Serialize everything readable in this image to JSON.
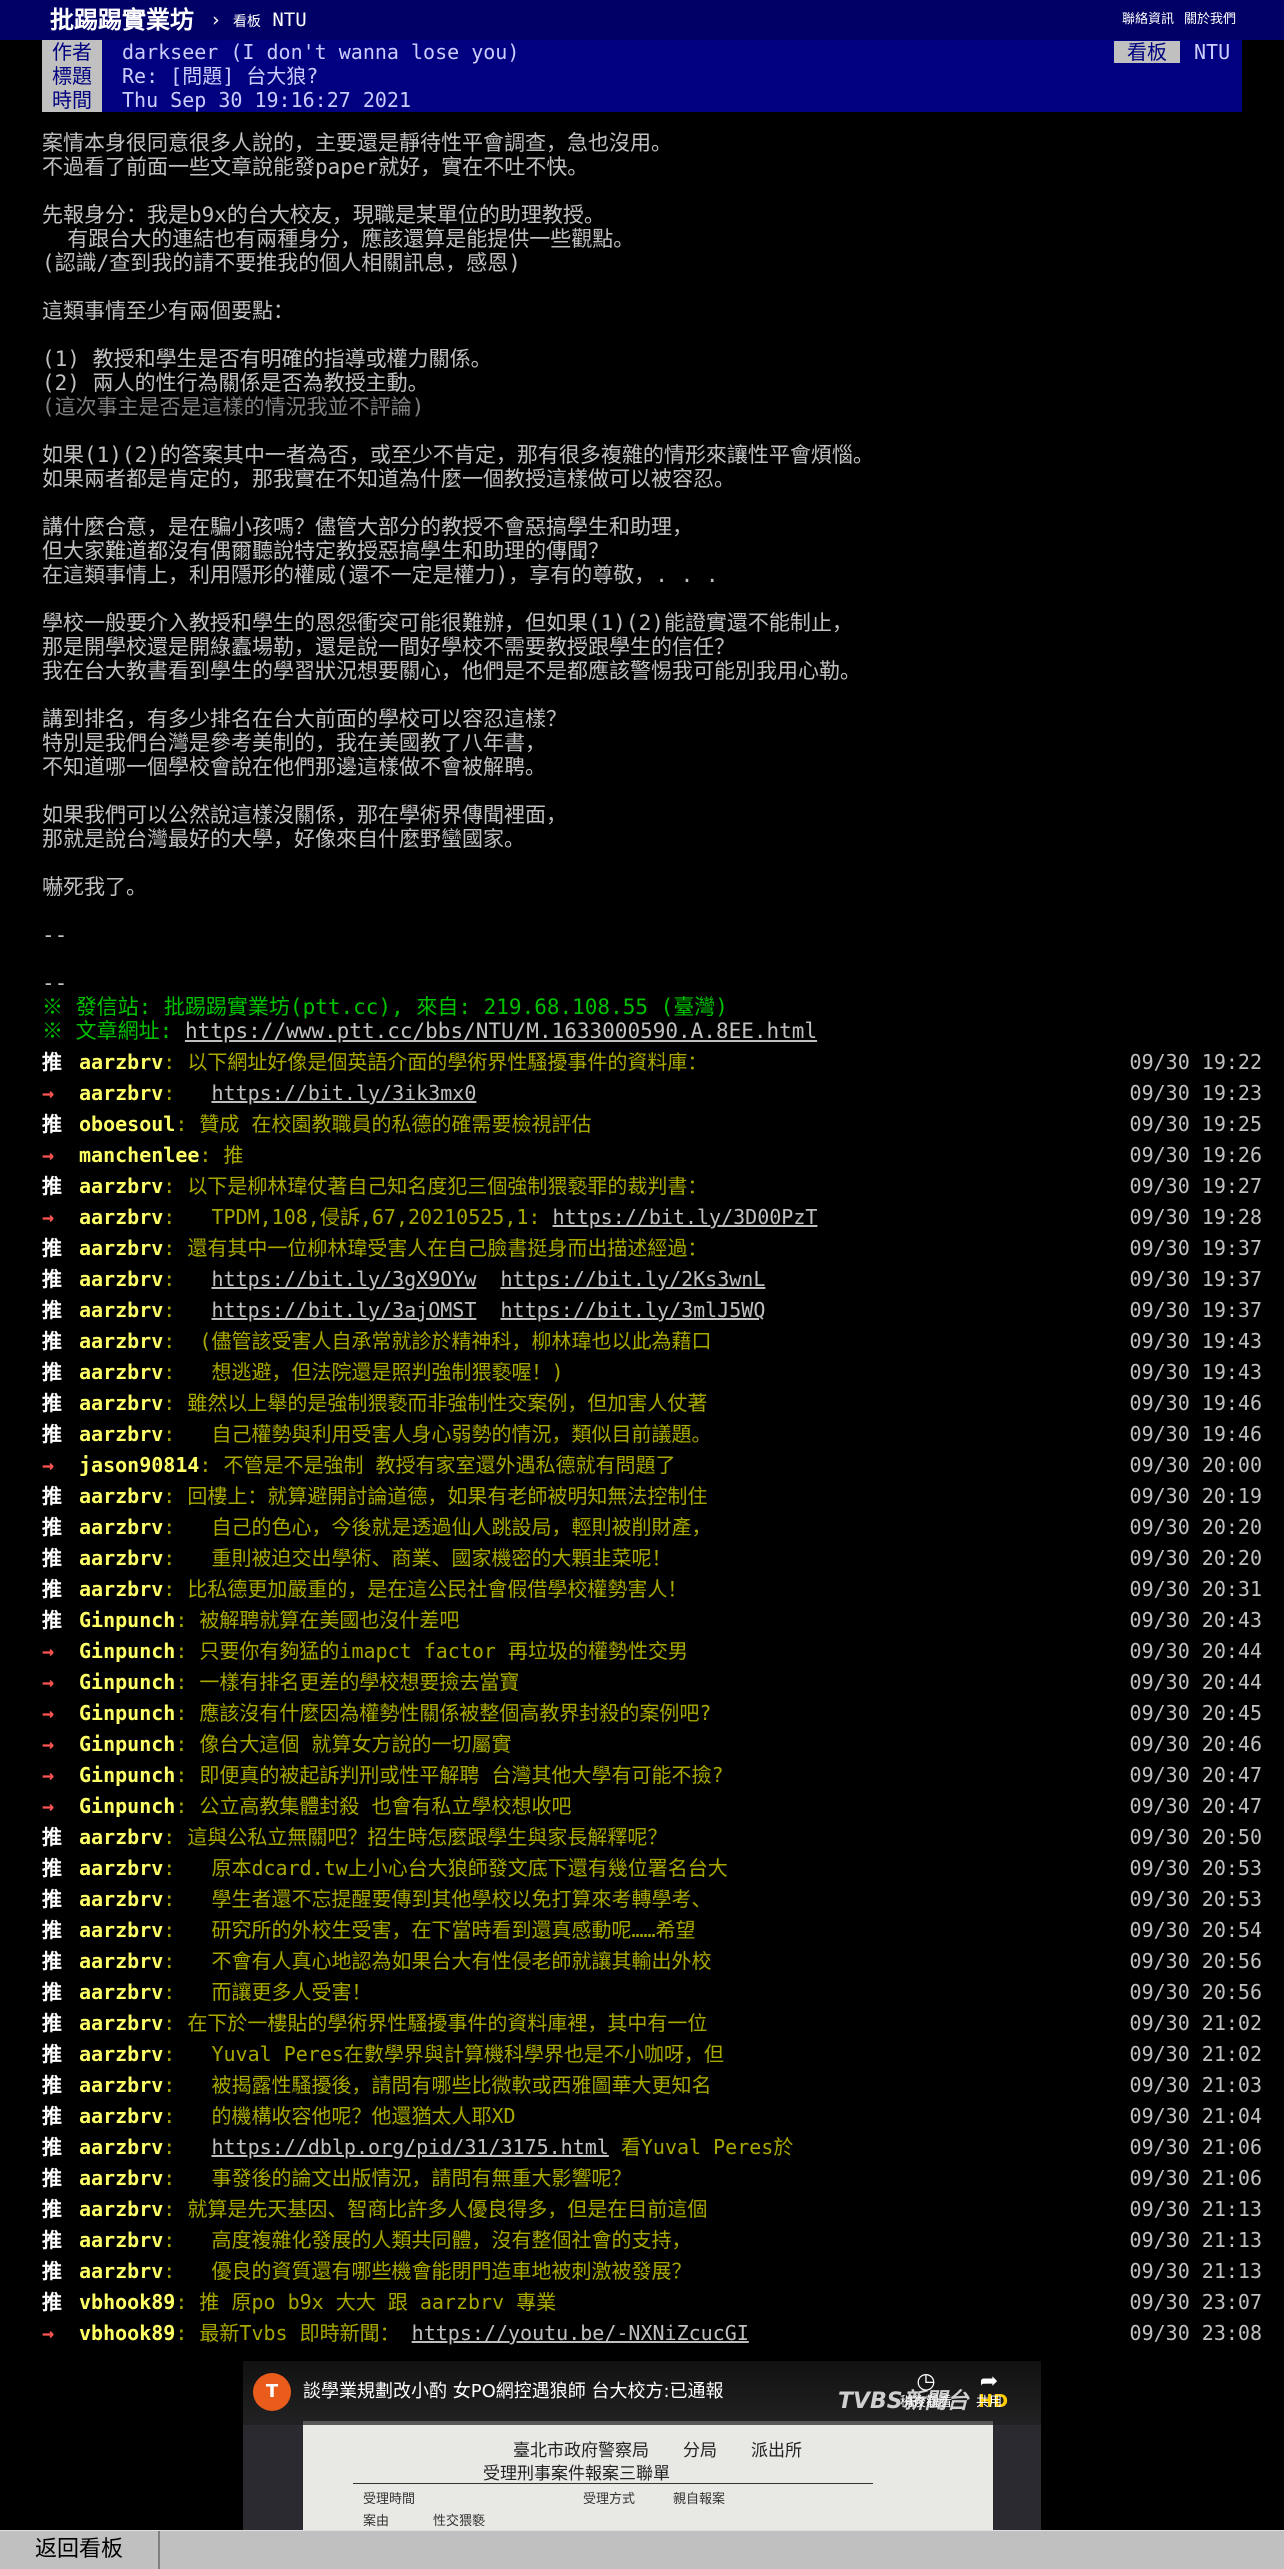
{
  "topbar": {
    "brand": "批踢踢實業坊",
    "separator": "›",
    "board_prefix": "看板",
    "board": "NTU",
    "links": [
      "聯絡資訊",
      "關於我們"
    ]
  },
  "meta": {
    "author_label": "作者",
    "author": "darkseer (I don't wanna lose you)",
    "board_label": "看板",
    "board": "NTU",
    "title_label": "標題",
    "title": "Re: [問題] 台大狼?",
    "time_label": "時間",
    "time": "Thu Sep 30 19:16:27 2021"
  },
  "body": [
    {
      "text": "案情本身很同意很多人說的，主要還是靜待性平會調查，急也沒用。"
    },
    {
      "text": "不過看了前面一些文章說能發paper就好，實在不吐不快。"
    },
    {
      "text": ""
    },
    {
      "text": "先報身分：我是b9x的台大校友，現職是某單位的助理教授。"
    },
    {
      "text": "  有跟台大的連結也有兩種身分，應該還算是能提供一些觀點。"
    },
    {
      "text": "(認識/查到我的請不要推我的個人相關訊息，感恩)"
    },
    {
      "text": ""
    },
    {
      "text": "這類事情至少有兩個要點："
    },
    {
      "text": ""
    },
    {
      "text": "(1) 教授和學生是否有明確的指導或權力關係。"
    },
    {
      "text": "(2) 兩人的性行為關係是否為教授主動。"
    },
    {
      "text": "(這次事主是否是這樣的情況我並不評論)",
      "dim": true
    },
    {
      "text": ""
    },
    {
      "text": "如果(1)(2)的答案其中一者為否，或至少不肯定，那有很多複雜的情形來讓性平會煩惱。"
    },
    {
      "text": "如果兩者都是肯定的，那我實在不知道為什麼一個教授這樣做可以被容忍。"
    },
    {
      "text": ""
    },
    {
      "text": "講什麼合意，是在騙小孩嗎？儘管大部分的教授不會惡搞學生和助理，"
    },
    {
      "text": "但大家難道都沒有偶爾聽說特定教授惡搞學生和助理的傳聞？"
    },
    {
      "text": "在這類事情上，利用隱形的權威(還不一定是權力)，享有的尊敬，. . ."
    },
    {
      "text": ""
    },
    {
      "text": "學校一般要介入教授和學生的恩怨衝突可能很難辦，但如果(1)(2)能證實還不能制止，"
    },
    {
      "text": "那是開學校還是開綠蠹場勒，還是說一間好學校不需要教授跟學生的信任？"
    },
    {
      "text": "我在台大教書看到學生的學習狀況想要關心，他們是不是都應該警惕我可能別我用心勒。"
    },
    {
      "text": ""
    },
    {
      "text": "講到排名，有多少排名在台大前面的學校可以容忍這樣？"
    },
    {
      "text": "特別是我們台灣是參考美制的，我在美國教了八年書，"
    },
    {
      "text": "不知道哪一個學校會說在他們那邊這樣做不會被解聘。"
    },
    {
      "text": ""
    },
    {
      "text": "如果我們可以公然說這樣沒關係，那在學術界傳聞裡面，"
    },
    {
      "text": "那就是說台灣最好的大學，好像來自什麼野蠻國家。"
    },
    {
      "text": ""
    },
    {
      "text": "嚇死我了。"
    },
    {
      "text": ""
    },
    {
      "text": "--"
    },
    {
      "text": ""
    },
    {
      "text": "--"
    }
  ],
  "footer": {
    "sent_from": "※ 發信站: 批踢踢實業坊(ptt.cc), 來自: 219.68.108.55 (臺灣)",
    "url_label": "※ 文章網址: ",
    "url": "https://www.ptt.cc/bbs/NTU/M.1633000590.A.8EE.html"
  },
  "pushes": [
    {
      "tag": "推",
      "user": "aarzbrv",
      "content": "以下網址好像是個英語介面的學術界性騷擾事件的資料庫：",
      "time": "09/30 19:22"
    },
    {
      "tag": "→",
      "user": "aarzbrv",
      "content": "  https://bit.ly/3ik3mx0",
      "time": "09/30 19:23"
    },
    {
      "tag": "推",
      "user": "oboesoul",
      "content": "贊成 在校園教職員的私德的確需要檢視評估",
      "time": "09/30 19:25"
    },
    {
      "tag": "→",
      "user": "manchenlee",
      "content": "推",
      "time": "09/30 19:26"
    },
    {
      "tag": "推",
      "user": "aarzbrv",
      "content": "以下是柳林瑋仗著自己知名度犯三個強制猥褻罪的裁判書：",
      "time": "09/30 19:27"
    },
    {
      "tag": "→",
      "user": "aarzbrv",
      "content": "  TPDM,108,侵訴,67,20210525,1: https://bit.ly/3D00PzT",
      "time": "09/30 19:28"
    },
    {
      "tag": "推",
      "user": "aarzbrv",
      "content": "還有其中一位柳林瑋受害人在自己臉書挺身而出描述經過：",
      "time": "09/30 19:37"
    },
    {
      "tag": "推",
      "user": "aarzbrv",
      "content": "  https://bit.ly/3gX9OYw  https://bit.ly/2Ks3wnL",
      "time": "09/30 19:37"
    },
    {
      "tag": "推",
      "user": "aarzbrv",
      "content": "  https://bit.ly/3ajOMST  https://bit.ly/3mlJ5WQ",
      "time": "09/30 19:37"
    },
    {
      "tag": "推",
      "user": "aarzbrv",
      "content": " (儘管該受害人自承常就診於精神科，柳林瑋也以此為藉口",
      "time": "09/30 19:43"
    },
    {
      "tag": "推",
      "user": "aarzbrv",
      "content": "  想逃避，但法院還是照判強制猥褻喔！)",
      "time": "09/30 19:43"
    },
    {
      "tag": "推",
      "user": "aarzbrv",
      "content": "雖然以上舉的是強制猥褻而非強制性交案例，但加害人仗著",
      "time": "09/30 19:46"
    },
    {
      "tag": "推",
      "user": "aarzbrv",
      "content": "  自己權勢與利用受害人身心弱勢的情況，類似目前議題。",
      "time": "09/30 19:46"
    },
    {
      "tag": "→",
      "user": "jason90814",
      "content": "不管是不是強制 教授有家室還外遇私德就有問題了",
      "time": "09/30 20:00"
    },
    {
      "tag": "推",
      "user": "aarzbrv",
      "content": "回樓上：就算避開討論道德，如果有老師被明知無法控制住",
      "time": "09/30 20:19"
    },
    {
      "tag": "推",
      "user": "aarzbrv",
      "content": "  自己的色心，今後就是透過仙人跳設局，輕則被削財產，",
      "time": "09/30 20:20"
    },
    {
      "tag": "推",
      "user": "aarzbrv",
      "content": "  重則被迫交出學術、商業、國家機密的大顆韭菜呢！",
      "time": "09/30 20:20"
    },
    {
      "tag": "推",
      "user": "aarzbrv",
      "content": "比私德更加嚴重的，是在這公民社會假借學校權勢害人！",
      "time": "09/30 20:31"
    },
    {
      "tag": "推",
      "user": "Ginpunch",
      "content": "被解聘就算在美國也沒什差吧",
      "time": "09/30 20:43"
    },
    {
      "tag": "→",
      "user": "Ginpunch",
      "content": "只要你有夠猛的imapct factor 再垃圾的權勢性交男",
      "time": "09/30 20:44"
    },
    {
      "tag": "→",
      "user": "Ginpunch",
      "content": "一樣有排名更差的學校想要撿去當寶",
      "time": "09/30 20:44"
    },
    {
      "tag": "→",
      "user": "Ginpunch",
      "content": "應該沒有什麼因為權勢性關係被整個高教界封殺的案例吧?",
      "time": "09/30 20:45"
    },
    {
      "tag": "→",
      "user": "Ginpunch",
      "content": "像台大這個 就算女方說的一切屬實",
      "time": "09/30 20:46"
    },
    {
      "tag": "→",
      "user": "Ginpunch",
      "content": "即便真的被起訴判刑或性平解聘 台灣其他大學有可能不撿?",
      "time": "09/30 20:47"
    },
    {
      "tag": "→",
      "user": "Ginpunch",
      "content": "公立高教集體封殺 也會有私立學校想收吧",
      "time": "09/30 20:47"
    },
    {
      "tag": "推",
      "user": "aarzbrv",
      "content": "這與公私立無關吧？招生時怎麼跟學生與家長解釋呢？",
      "time": "09/30 20:50"
    },
    {
      "tag": "推",
      "user": "aarzbrv",
      "content": "  原本dcard.tw上小心台大狼師發文底下還有幾位署名台大",
      "time": "09/30 20:53"
    },
    {
      "tag": "推",
      "user": "aarzbrv",
      "content": "  學生者還不忘提醒要傳到其他學校以免打算來考轉學考、",
      "time": "09/30 20:53"
    },
    {
      "tag": "推",
      "user": "aarzbrv",
      "content": "  研究所的外校生受害，在下當時看到還真感動呢……希望",
      "time": "09/30 20:54"
    },
    {
      "tag": "推",
      "user": "aarzbrv",
      "content": "  不會有人真心地認為如果台大有性侵老師就讓其輸出外校",
      "time": "09/30 20:56"
    },
    {
      "tag": "推",
      "user": "aarzbrv",
      "content": "  而讓更多人受害！",
      "time": "09/30 20:56"
    },
    {
      "tag": "推",
      "user": "aarzbrv",
      "content": "在下於一樓貼的學術界性騷擾事件的資料庫裡，其中有一位",
      "time": "09/30 21:02"
    },
    {
      "tag": "推",
      "user": "aarzbrv",
      "content": "  Yuval Peres在數學界與計算機科學界也是不小咖呀，但",
      "time": "09/30 21:02"
    },
    {
      "tag": "推",
      "user": "aarzbrv",
      "content": "  被揭露性騷擾後，請問有哪些比微軟或西雅圖華大更知名",
      "time": "09/30 21:03"
    },
    {
      "tag": "推",
      "user": "aarzbrv",
      "content": "  的機構收容他呢？他還猶太人耶XD",
      "time": "09/30 21:04"
    },
    {
      "tag": "推",
      "user": "aarzbrv",
      "content": "  https://dblp.org/pid/31/3175.html 看Yuval Peres於",
      "time": "09/30 21:06"
    },
    {
      "tag": "推",
      "user": "aarzbrv",
      "content": "  事發後的論文出版情況，請問有無重大影響呢？",
      "time": "09/30 21:06"
    },
    {
      "tag": "推",
      "user": "aarzbrv",
      "content": "就算是先天基因、智商比許多人優良得多，但是在目前這個",
      "time": "09/30 21:13"
    },
    {
      "tag": "推",
      "user": "aarzbrv",
      "content": "  高度複雜化發展的人類共同體，沒有整個社會的支持，",
      "time": "09/30 21:13"
    },
    {
      "tag": "推",
      "user": "aarzbrv",
      "content": "  優良的資質還有哪些機會能閉門造車地被刺激被發展？",
      "time": "09/30 21:13"
    },
    {
      "tag": "推",
      "user": "vbhook89",
      "content": "推 原po b9x 大大 跟 aarzbrv 專業",
      "time": "09/30 23:07"
    },
    {
      "tag": "→",
      "user": "vbhook89",
      "content": "最新Tvbs 即時新聞： https://youtu.be/-NXNiZcucGI",
      "time": "09/30 23:08"
    }
  ],
  "video": {
    "channel_icon": "T",
    "title": "談學業規劃改小酌 女PO網控遇狼師 台大校方:已通報",
    "logo": "TVBS新聞台",
    "hd": "HD",
    "watch_later_label": "稍後觀看",
    "share_label": "共用",
    "doc_line1": "臺北市政府警察局　　分局　　派出所",
    "doc_line2": "受理刑事案件報案三聯單",
    "doc_cells": [
      "受理時間",
      "受理方式",
      "親自報案",
      "案由",
      "性交猥褻"
    ]
  },
  "bottombar": {
    "back_label": "返回看板"
  }
}
